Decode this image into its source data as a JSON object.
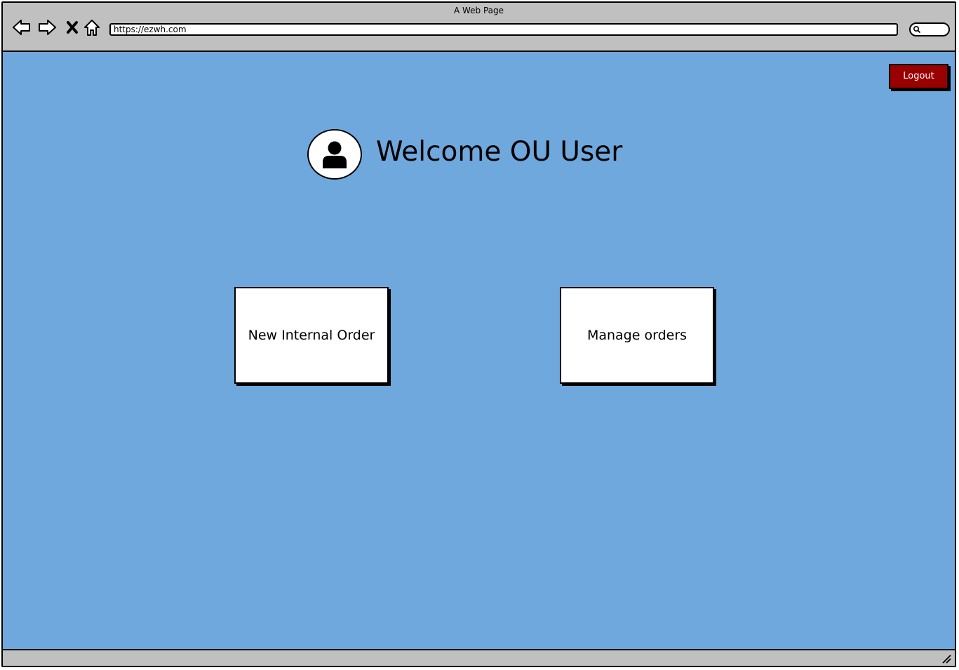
{
  "window": {
    "title": "A Web Page"
  },
  "toolbar": {
    "back_icon": "arrow-left-icon",
    "forward_icon": "arrow-right-icon",
    "stop_icon": "close-icon",
    "home_icon": "home-icon",
    "url": "https://ezwh.com",
    "search_icon": "search-icon"
  },
  "page": {
    "background_color": "#6fa8dc",
    "logout_label": "Logout",
    "logout_color": "#990000",
    "welcome_title": "Welcome OU User",
    "avatar_icon": "user-icon",
    "actions": [
      {
        "label": "New Internal Order"
      },
      {
        "label": "Manage orders"
      }
    ]
  },
  "statusbar": {
    "resize_icon": "resize-grip-icon"
  }
}
